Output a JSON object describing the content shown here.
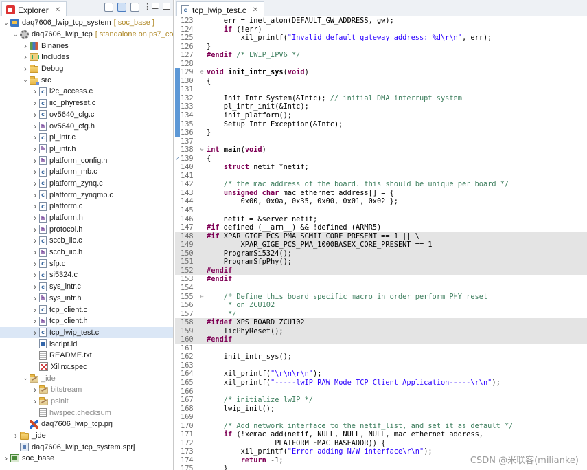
{
  "explorer": {
    "tab_label": "Explorer",
    "tree": [
      {
        "indent": 0,
        "twisty": "open",
        "icon": "project",
        "label": "daq7606_lwip_tcp_system",
        "extra": "[ soc_base ]"
      },
      {
        "indent": 1,
        "twisty": "open",
        "icon": "gear",
        "label": "daq7606_lwip_tcp",
        "extra": "[ standalone on ps7_co"
      },
      {
        "indent": 2,
        "twisty": "closed",
        "icon": "bins",
        "label": "Binaries"
      },
      {
        "indent": 2,
        "twisty": "closed",
        "icon": "incl",
        "label": "Includes"
      },
      {
        "indent": 2,
        "twisty": "closed",
        "icon": "folder",
        "label": "Debug"
      },
      {
        "indent": 2,
        "twisty": "open",
        "icon": "folder-src",
        "label": "src"
      },
      {
        "indent": 3,
        "twisty": "closed",
        "icon": "c",
        "label": "i2c_access.c"
      },
      {
        "indent": 3,
        "twisty": "closed",
        "icon": "c",
        "label": "iic_phyreset.c"
      },
      {
        "indent": 3,
        "twisty": "closed",
        "icon": "c",
        "label": "ov5640_cfg.c"
      },
      {
        "indent": 3,
        "twisty": "closed",
        "icon": "h",
        "label": "ov5640_cfg.h"
      },
      {
        "indent": 3,
        "twisty": "closed",
        "icon": "c",
        "label": "pl_intr.c"
      },
      {
        "indent": 3,
        "twisty": "closed",
        "icon": "h",
        "label": "pl_intr.h"
      },
      {
        "indent": 3,
        "twisty": "closed",
        "icon": "h",
        "label": "platform_config.h"
      },
      {
        "indent": 3,
        "twisty": "closed",
        "icon": "c",
        "label": "platform_mb.c"
      },
      {
        "indent": 3,
        "twisty": "closed",
        "icon": "c",
        "label": "platform_zynq.c"
      },
      {
        "indent": 3,
        "twisty": "closed",
        "icon": "c",
        "label": "platform_zynqmp.c"
      },
      {
        "indent": 3,
        "twisty": "closed",
        "icon": "c",
        "label": "platform.c"
      },
      {
        "indent": 3,
        "twisty": "closed",
        "icon": "h",
        "label": "platform.h"
      },
      {
        "indent": 3,
        "twisty": "closed",
        "icon": "h",
        "label": "protocol.h"
      },
      {
        "indent": 3,
        "twisty": "closed",
        "icon": "c",
        "label": "sccb_iic.c"
      },
      {
        "indent": 3,
        "twisty": "closed",
        "icon": "h",
        "label": "sccb_iic.h"
      },
      {
        "indent": 3,
        "twisty": "closed",
        "icon": "c",
        "label": "sfp.c"
      },
      {
        "indent": 3,
        "twisty": "closed",
        "icon": "c",
        "label": "si5324.c"
      },
      {
        "indent": 3,
        "twisty": "closed",
        "icon": "c",
        "label": "sys_intr.c"
      },
      {
        "indent": 3,
        "twisty": "closed",
        "icon": "h",
        "label": "sys_intr.h"
      },
      {
        "indent": 3,
        "twisty": "closed",
        "icon": "c",
        "label": "tcp_client.c"
      },
      {
        "indent": 3,
        "twisty": "closed",
        "icon": "h",
        "label": "tcp_client.h"
      },
      {
        "indent": 3,
        "twisty": "closed",
        "icon": "c",
        "label": "tcp_lwip_test.c",
        "selected": true
      },
      {
        "indent": 3,
        "twisty": "none",
        "icon": "ld",
        "label": "lscript.ld"
      },
      {
        "indent": 3,
        "twisty": "none",
        "icon": "doc",
        "label": "README.txt"
      },
      {
        "indent": 3,
        "twisty": "none",
        "icon": "xspec",
        "label": "Xilinx.spec"
      },
      {
        "indent": 2,
        "twisty": "open",
        "icon": "folder-gray",
        "label": "_ide",
        "muted": true
      },
      {
        "indent": 3,
        "twisty": "closed",
        "icon": "folder-gray",
        "label": "bitstream",
        "muted": true
      },
      {
        "indent": 3,
        "twisty": "closed",
        "icon": "folder-gray",
        "label": "psinit",
        "muted": true
      },
      {
        "indent": 3,
        "twisty": "none",
        "icon": "doc",
        "label": "hwspec.checksum",
        "muted": true
      },
      {
        "indent": 2,
        "twisty": "none",
        "icon": "prj",
        "label": "daq7606_lwip_tcp.prj"
      },
      {
        "indent": 1,
        "twisty": "closed",
        "icon": "folder",
        "label": "_ide"
      },
      {
        "indent": 1,
        "twisty": "none",
        "icon": "sprj",
        "label": "daq7606_lwip_tcp_system.sprj"
      },
      {
        "indent": 0,
        "twisty": "closed",
        "icon": "soc",
        "label": "soc_base"
      }
    ]
  },
  "editor": {
    "tab_label": "tcp_lwip_test.c",
    "lines": [
      {
        "n": "123",
        "segs": [
          [
            "",
            "    err = inet_aton(DEFAULT_GW_ADDRESS, gw);"
          ]
        ]
      },
      {
        "n": "124",
        "segs": [
          [
            "",
            "    "
          ],
          [
            "kw",
            "if"
          ],
          [
            "",
            " (!err)"
          ]
        ]
      },
      {
        "n": "125",
        "segs": [
          [
            "",
            "        xil_printf("
          ],
          [
            "str",
            "\"Invalid default gateway address: %d\\r\\n\""
          ],
          [
            "",
            ", err);"
          ]
        ]
      },
      {
        "n": "126",
        "segs": [
          [
            "",
            "}"
          ]
        ]
      },
      {
        "n": "127",
        "segs": [
          [
            "pp",
            "#endif"
          ],
          [
            "ppc",
            " /* LWIP_IPV6 */"
          ]
        ]
      },
      {
        "n": "128",
        "segs": [
          [
            "",
            ""
          ]
        ]
      },
      {
        "n": "129",
        "fold": "⊖",
        "segs": [
          [
            "kw",
            "void"
          ],
          [
            "fn",
            " init_intr_sys"
          ],
          [
            "",
            "("
          ],
          [
            "kw",
            "void"
          ],
          [
            "",
            ")"
          ]
        ]
      },
      {
        "n": "130",
        "segs": [
          [
            "",
            "{"
          ]
        ]
      },
      {
        "n": "131",
        "segs": [
          [
            "",
            ""
          ]
        ]
      },
      {
        "n": "132",
        "segs": [
          [
            "",
            "    Init_Intr_System(&Intc); "
          ],
          [
            "cm",
            "// initial DMA interrupt system"
          ]
        ]
      },
      {
        "n": "133",
        "segs": [
          [
            "",
            "    pl_intr_init(&Intc);"
          ]
        ]
      },
      {
        "n": "134",
        "segs": [
          [
            "",
            "    init_platform();"
          ]
        ]
      },
      {
        "n": "135",
        "segs": [
          [
            "",
            "    Setup_Intr_Exception(&Intc);"
          ]
        ]
      },
      {
        "n": "136",
        "segs": [
          [
            "",
            "}"
          ]
        ]
      },
      {
        "n": "137",
        "segs": [
          [
            "",
            ""
          ]
        ]
      },
      {
        "n": "138",
        "fold": "⊖",
        "segs": [
          [
            "kw",
            "int"
          ],
          [
            "fn",
            " main"
          ],
          [
            "",
            "("
          ],
          [
            "kw",
            "void"
          ],
          [
            "",
            ")"
          ]
        ]
      },
      {
        "n": "139",
        "mark": "check",
        "segs": [
          [
            "",
            "{"
          ]
        ]
      },
      {
        "n": "140",
        "segs": [
          [
            "",
            "    "
          ],
          [
            "kw",
            "struct"
          ],
          [
            "",
            " netif *netif;"
          ]
        ]
      },
      {
        "n": "141",
        "segs": [
          [
            "",
            ""
          ]
        ]
      },
      {
        "n": "142",
        "segs": [
          [
            "cm",
            "    /* the mac address of the board. this should be unique per board */"
          ]
        ]
      },
      {
        "n": "143",
        "segs": [
          [
            "",
            "    "
          ],
          [
            "kw",
            "unsigned"
          ],
          [
            "",
            " "
          ],
          [
            "kw",
            "char"
          ],
          [
            "",
            " mac_ethernet_address[] = {"
          ]
        ]
      },
      {
        "n": "144",
        "segs": [
          [
            "",
            "        0x00, 0x0a, 0x35, 0x00, 0x01, 0x02 };"
          ]
        ]
      },
      {
        "n": "145",
        "segs": [
          [
            "",
            ""
          ]
        ]
      },
      {
        "n": "146",
        "segs": [
          [
            "",
            "    netif = &server_netif;"
          ]
        ]
      },
      {
        "n": "147",
        "segs": [
          [
            "pp",
            "#if"
          ],
          [
            "",
            " defined (__arm__) && !defined (ARMR5)"
          ]
        ]
      },
      {
        "n": "148",
        "hl": true,
        "segs": [
          [
            "pp",
            "#if"
          ],
          [
            "",
            " XPAR_GIGE_PCS_PMA_SGMII_CORE_PRESENT == 1 || \\"
          ]
        ]
      },
      {
        "n": "149",
        "hl": true,
        "segs": [
          [
            "",
            "        XPAR_GIGE_PCS_PMA_1000BASEX_CORE_PRESENT == 1"
          ]
        ]
      },
      {
        "n": "150",
        "hl": true,
        "segs": [
          [
            "",
            "    ProgramSi5324();"
          ]
        ]
      },
      {
        "n": "151",
        "hl": true,
        "segs": [
          [
            "",
            "    ProgramSfpPhy();"
          ]
        ]
      },
      {
        "n": "152",
        "hl": true,
        "segs": [
          [
            "pp",
            "#endif"
          ]
        ]
      },
      {
        "n": "153",
        "segs": [
          [
            "pp",
            "#endif"
          ]
        ]
      },
      {
        "n": "154",
        "segs": [
          [
            "",
            ""
          ]
        ]
      },
      {
        "n": "155",
        "fold": "⊖",
        "segs": [
          [
            "cm",
            "    /* Define this board specific macro in order perform PHY reset"
          ]
        ]
      },
      {
        "n": "156",
        "segs": [
          [
            "cm",
            "     * on ZCU102"
          ]
        ]
      },
      {
        "n": "157",
        "segs": [
          [
            "cm",
            "     */"
          ]
        ]
      },
      {
        "n": "158",
        "hl": true,
        "segs": [
          [
            "pp",
            "#ifdef"
          ],
          [
            "",
            " XPS_BOARD_ZCU102"
          ]
        ]
      },
      {
        "n": "159",
        "hl": true,
        "segs": [
          [
            "",
            "    IicPhyReset();"
          ]
        ]
      },
      {
        "n": "160",
        "hl": true,
        "segs": [
          [
            "pp",
            "#endif"
          ]
        ]
      },
      {
        "n": "161",
        "segs": [
          [
            "",
            ""
          ]
        ]
      },
      {
        "n": "162",
        "segs": [
          [
            "",
            "    init_intr_sys();"
          ]
        ]
      },
      {
        "n": "163",
        "segs": [
          [
            "",
            ""
          ]
        ]
      },
      {
        "n": "164",
        "segs": [
          [
            "",
            "    xil_printf("
          ],
          [
            "str",
            "\"\\r\\n\\r\\n\""
          ],
          [
            "",
            ");"
          ]
        ]
      },
      {
        "n": "165",
        "segs": [
          [
            "",
            "    xil_printf("
          ],
          [
            "str",
            "\"-----lwIP RAW Mode TCP Client Application-----\\r\\n\""
          ],
          [
            "",
            ");"
          ]
        ]
      },
      {
        "n": "166",
        "segs": [
          [
            "",
            ""
          ]
        ]
      },
      {
        "n": "167",
        "segs": [
          [
            "cm",
            "    /* initialize lwIP */"
          ]
        ]
      },
      {
        "n": "168",
        "segs": [
          [
            "",
            "    lwip_init();"
          ]
        ]
      },
      {
        "n": "169",
        "segs": [
          [
            "",
            ""
          ]
        ]
      },
      {
        "n": "170",
        "segs": [
          [
            "cm",
            "    /* Add network interface to the netif_list, and set it as default */"
          ]
        ]
      },
      {
        "n": "171",
        "segs": [
          [
            "",
            "    "
          ],
          [
            "kw",
            "if"
          ],
          [
            "",
            " (!xemac_add(netif, NULL, NULL, NULL, mac_ethernet_address,"
          ]
        ]
      },
      {
        "n": "172",
        "segs": [
          [
            "",
            "                PLATFORM_EMAC_BASEADDR)) {"
          ]
        ]
      },
      {
        "n": "173",
        "segs": [
          [
            "",
            "        xil_printf("
          ],
          [
            "str",
            "\"Error adding N/W interface\\r\\n\""
          ],
          [
            "",
            ");"
          ]
        ]
      },
      {
        "n": "174",
        "segs": [
          [
            "",
            "        "
          ],
          [
            "kw",
            "return"
          ],
          [
            "",
            " -1;"
          ]
        ]
      },
      {
        "n": "175",
        "segs": [
          [
            "",
            "    }"
          ]
        ]
      }
    ]
  },
  "watermark": "CSDN @米联客(milianke)"
}
